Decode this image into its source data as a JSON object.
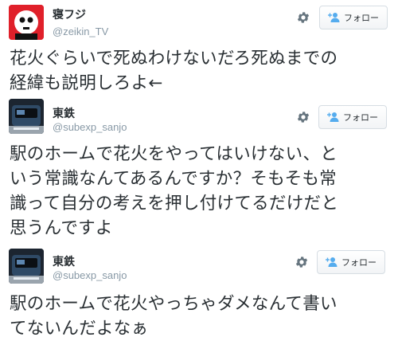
{
  "tweets": [
    {
      "name": "寝フジ",
      "handle": "@zeikin_TV",
      "follow_label": "フォロー",
      "text_lines": [
        "花火ぐらいで死ぬわけないだろ死ぬまでの",
        "経緯も説明しろよ←"
      ]
    },
    {
      "name": "東鉄",
      "handle": "@subexp_sanjo",
      "follow_label": "フォロー",
      "text_lines": [
        "駅のホームで花火をやってはいけない、と",
        "いう常識なんてあるんですか？そもそも常",
        "識って自分の考えを押し付けてるだけだと",
        "思うんですよ"
      ]
    },
    {
      "name": "東鉄",
      "handle": "@subexp_sanjo",
      "follow_label": "フォロー",
      "text_lines": [
        "駅のホームで花火やっちゃダメなんて書い",
        "てないんだよなぁ"
      ]
    }
  ],
  "colors": {
    "avatar1_bg": "#e0202a",
    "avatar2_bg": "#1c2530",
    "follow_icon": "#55acee",
    "gear": "#66757f"
  },
  "icons": [
    "gear-icon",
    "follow-person-plus-icon"
  ]
}
